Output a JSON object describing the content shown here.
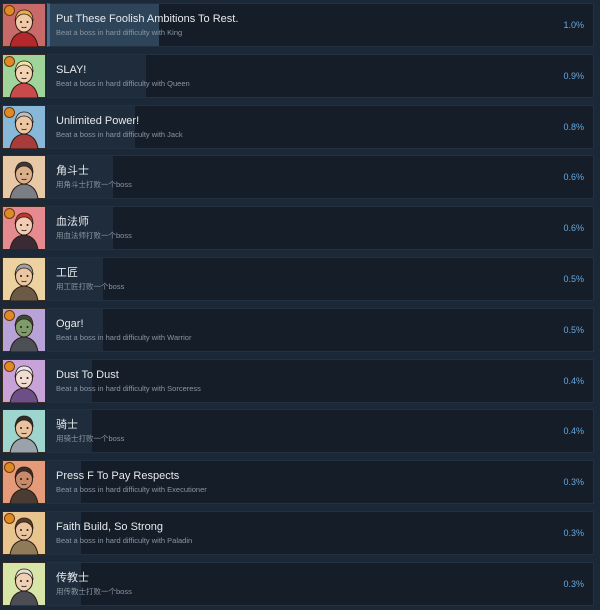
{
  "achievements": [
    {
      "title": "Put These Foolish Ambitions To Rest.",
      "desc": "Beat a boss in hard difficulty with King",
      "pct": "1.0%",
      "pct_value": 1.0,
      "icon": "king-portrait-icon",
      "bg": "#c96a6a",
      "skin": "#f0c9a8",
      "hair": "#e9b04a",
      "cloth": "#b4272a"
    },
    {
      "title": "SLAY!",
      "desc": "Beat a boss in hard difficulty with Queen",
      "pct": "0.9%",
      "pct_value": 0.9,
      "icon": "queen-portrait-icon",
      "bg": "#9fd49b",
      "skin": "#f2d3b4",
      "hair": "#efe3a6",
      "cloth": "#c94a4a"
    },
    {
      "title": "Unlimited Power!",
      "desc": "Beat a boss in hard difficulty with Jack",
      "pct": "0.8%",
      "pct_value": 0.8,
      "icon": "jack-portrait-icon",
      "bg": "#87b8d8",
      "skin": "#ecc7a3",
      "hair": "#b9c2c9",
      "cloth": "#a73c3a"
    },
    {
      "title": "角斗士",
      "desc": "用角斗士打败一个boss",
      "pct": "0.6%",
      "pct_value": 0.6,
      "icon": "gladiator-portrait-icon",
      "bg": "#e7c9a8",
      "skin": "#d9b08a",
      "hair": "#3a3a3a",
      "cloth": "#7a7f86"
    },
    {
      "title": "血法师",
      "desc": "用血法师打败一个boss",
      "pct": "0.6%",
      "pct_value": 0.6,
      "icon": "blood-mage-portrait-icon",
      "bg": "#e58a8e",
      "skin": "#f2cdb5",
      "hair": "#b93a2c",
      "cloth": "#3a2a33"
    },
    {
      "title": "工匠",
      "desc": "用工匠打败一个boss",
      "pct": "0.5%",
      "pct_value": 0.5,
      "icon": "craftsman-portrait-icon",
      "bg": "#ecd2a0",
      "skin": "#eac6a3",
      "hair": "#9fa3a6",
      "cloth": "#6b5a45"
    },
    {
      "title": "Ogar!",
      "desc": "Beat a boss in hard difficulty with Warrior",
      "pct": "0.5%",
      "pct_value": 0.5,
      "icon": "warrior-portrait-icon",
      "bg": "#b8a3d8",
      "skin": "#7e9c6b",
      "hair": "#3b4a33",
      "cloth": "#4c4f55"
    },
    {
      "title": "Dust To Dust",
      "desc": "Beat a boss in hard difficulty with Sorceress",
      "pct": "0.4%",
      "pct_value": 0.4,
      "icon": "sorceress-portrait-icon",
      "bg": "#c7a3d9",
      "skin": "#f0dcd2",
      "hair": "#e8e6ef",
      "cloth": "#6c4f86"
    },
    {
      "title": "骑士",
      "desc": "用骑士打败一个boss",
      "pct": "0.4%",
      "pct_value": 0.4,
      "icon": "knight-portrait-icon",
      "bg": "#9ed6cf",
      "skin": "#e7c3a1",
      "hair": "#2d2d2d",
      "cloth": "#9aa3ab"
    },
    {
      "title": "Press F To Pay Respects",
      "desc": "Beat a boss in hard difficulty with Executioner",
      "pct": "0.3%",
      "pct_value": 0.3,
      "icon": "executioner-portrait-icon",
      "bg": "#e59a7a",
      "skin": "#c98a6b",
      "hair": "#3a2b26",
      "cloth": "#4a3b33"
    },
    {
      "title": "Faith Build, So Strong",
      "desc": "Beat a boss in hard difficulty with Paladin",
      "pct": "0.3%",
      "pct_value": 0.3,
      "icon": "paladin-portrait-icon",
      "bg": "#e8c48e",
      "skin": "#ebc4a0",
      "hair": "#5a3b26",
      "cloth": "#8f7a5a"
    },
    {
      "title": "传教士",
      "desc": "用传教士打败一个boss",
      "pct": "0.3%",
      "pct_value": 0.3,
      "icon": "missionary-portrait-icon",
      "bg": "#d7e6a8",
      "skin": "#eed0b4",
      "hair": "#e4e0d6",
      "cloth": "#4d4d55"
    }
  ]
}
